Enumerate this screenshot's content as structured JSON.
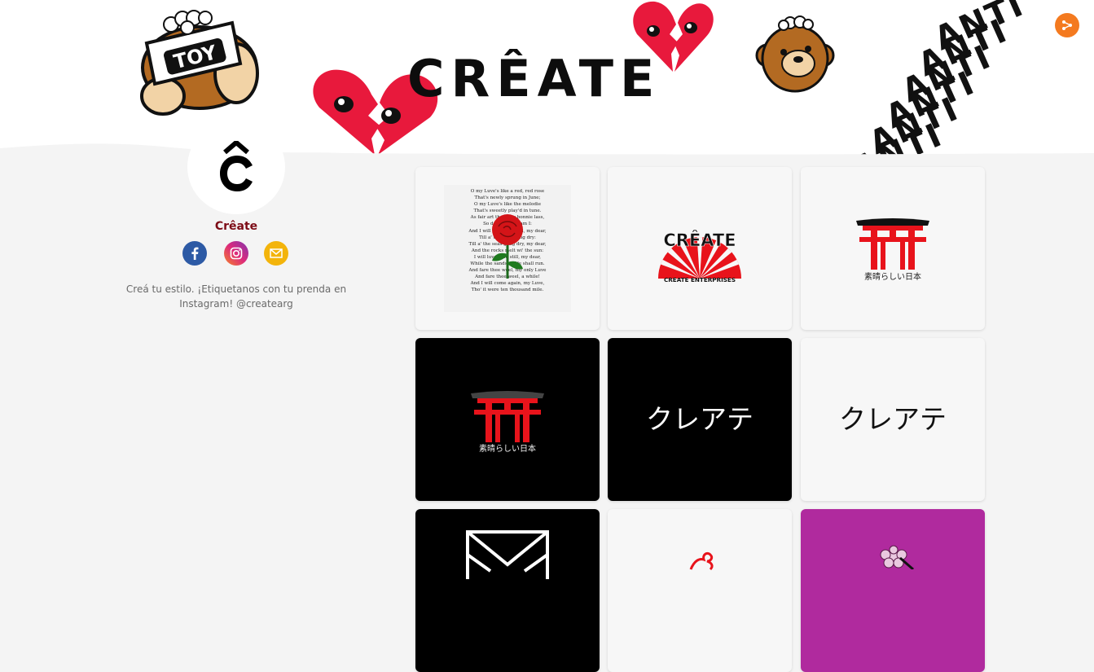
{
  "banner": {
    "brand_wordmark": "CRÊATE",
    "toy_label": "TOY",
    "anti_repeated": [
      "ANTI",
      "ANTI",
      "ANTI",
      "ANTI",
      "ANTI",
      "ANTI"
    ],
    "colors": {
      "heart_red": "#e8193c",
      "bear_brown": "#b36a22"
    }
  },
  "share_button": {
    "icon": "share-icon",
    "color": "#f47a1f"
  },
  "profile": {
    "avatar_letter": "Ĉ",
    "name": "Crêate",
    "name_color": "#7d0c16",
    "bio": "Creá tu estilo. ¡Etiquetanos con tu prenda en Instagram! @createarg",
    "socials": [
      {
        "name": "facebook",
        "icon": "facebook-icon",
        "color": "#2d5aa5"
      },
      {
        "name": "instagram",
        "icon": "instagram-icon",
        "color": "#d6297a"
      },
      {
        "name": "email",
        "icon": "email-icon",
        "color": "#f3b40b"
      }
    ]
  },
  "grid": {
    "poem_lines": [
      "O my Luve's like a red, red rose",
      "That's newly sprung in June;",
      "O my Luve's like the melodie",
      "That's sweetly play'd in tune.",
      "As fair art thou, my bonnie lass,",
      "So deep in luve am I:",
      "And I will luve thee still, my dear,",
      "Till a' the seas gang dry:",
      "Till a' the seas gang dry, my dear,",
      "And the rocks melt wi' the sun:",
      "I will luve thee still, my dear,",
      "While the sands o' life shall run.",
      "And fare thee weel, my only Luve",
      "And fare thee weel, a while!",
      "And I will come again, my Luve,",
      "Tho' it were ten thousand mile."
    ],
    "logo_top_text": "CRÊATE",
    "logo_bottom_text": "CREATE ENTERPRISES",
    "torii_caption_light": "素晴らしい日本",
    "torii_caption_dark": "素晴らしい日本",
    "kana_dark": "クレアテ",
    "kana_light": "クレアテ"
  }
}
